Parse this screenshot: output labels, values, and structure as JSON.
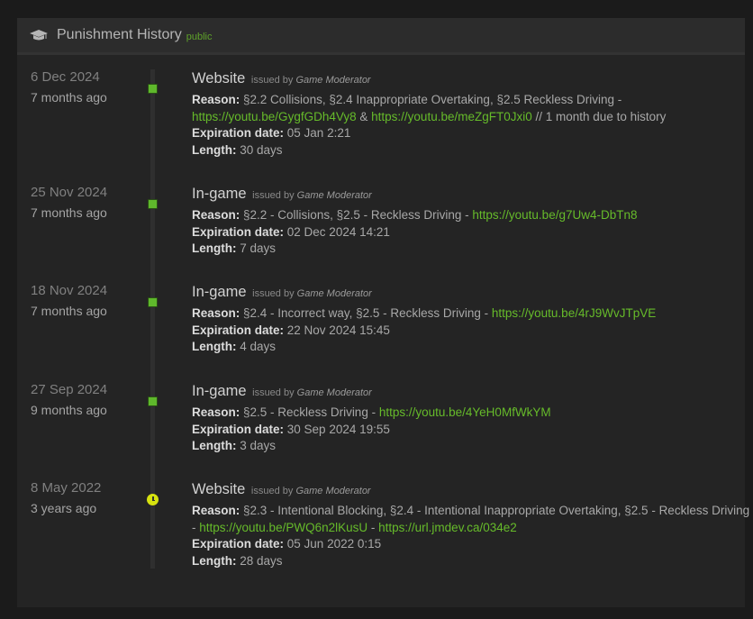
{
  "panel": {
    "icon": "graduation-cap-icon",
    "title": "Punishment History",
    "tag": "public"
  },
  "labels": {
    "issued_by": "issued by",
    "reason": "Reason:",
    "expiration": "Expiration date:",
    "length": "Length:"
  },
  "colors": {
    "accent_green": "#66bb2a",
    "marker_green": "#5fb82c",
    "marker_clock_yellow": "#d6e20f"
  },
  "entries": [
    {
      "date": "6 Dec 2024",
      "ago": "7 months ago",
      "source": "Website",
      "moderator": "Game Moderator",
      "marker": "active",
      "reason_part1": "§2.2 Collisions, §2.4 Inappropriate Overtaking, §2.5 Reckless Driving -",
      "link1": "https://youtu.be/GygfGDh4Vy8",
      "amp": "&",
      "link2": "https://youtu.be/meZgFT0Jxi0",
      "reason_part2": "// 1 month due to history",
      "expiration": "05 Jan 2:21",
      "length": "30 days"
    },
    {
      "date": "25 Nov 2024",
      "ago": "7 months ago",
      "source": "In-game",
      "moderator": "Game Moderator",
      "marker": "active",
      "reason": "§2.2 - Collisions, §2.5 - Reckless Driving -",
      "link": "https://youtu.be/g7Uw4-DbTn8",
      "expiration": "02 Dec 2024 14:21",
      "length": "7 days"
    },
    {
      "date": "18 Nov 2024",
      "ago": "7 months ago",
      "source": "In-game",
      "moderator": "Game Moderator",
      "marker": "active",
      "reason": "§2.4 - Incorrect way, §2.5 - Reckless Driving -",
      "link": "https://youtu.be/4rJ9WvJTpVE",
      "expiration": "22 Nov 2024 15:45",
      "length": "4 days"
    },
    {
      "date": "27 Sep 2024",
      "ago": "9 months ago",
      "source": "In-game",
      "moderator": "Game Moderator",
      "marker": "active",
      "reason": "§2.5 - Reckless Driving -",
      "link": "https://youtu.be/4YeH0MfWkYM",
      "expiration": "30 Sep 2024 19:55",
      "length": "3 days"
    },
    {
      "date": "8 May 2022",
      "ago": "3 years ago",
      "source": "Website",
      "moderator": "Game Moderator",
      "marker": "clock",
      "reason_part1": "§2.3 - Intentional Blocking, §2.4 - Intentional Inappropriate Overtaking, §2.5 - Reckless Driving",
      "dash1": "-",
      "link1": "https://youtu.be/PWQ6n2lKusU",
      "dash2": "-",
      "link2": "https://url.jmdev.ca/034e2",
      "expiration": "05 Jun 2022 0:15",
      "length": "28 days"
    }
  ]
}
